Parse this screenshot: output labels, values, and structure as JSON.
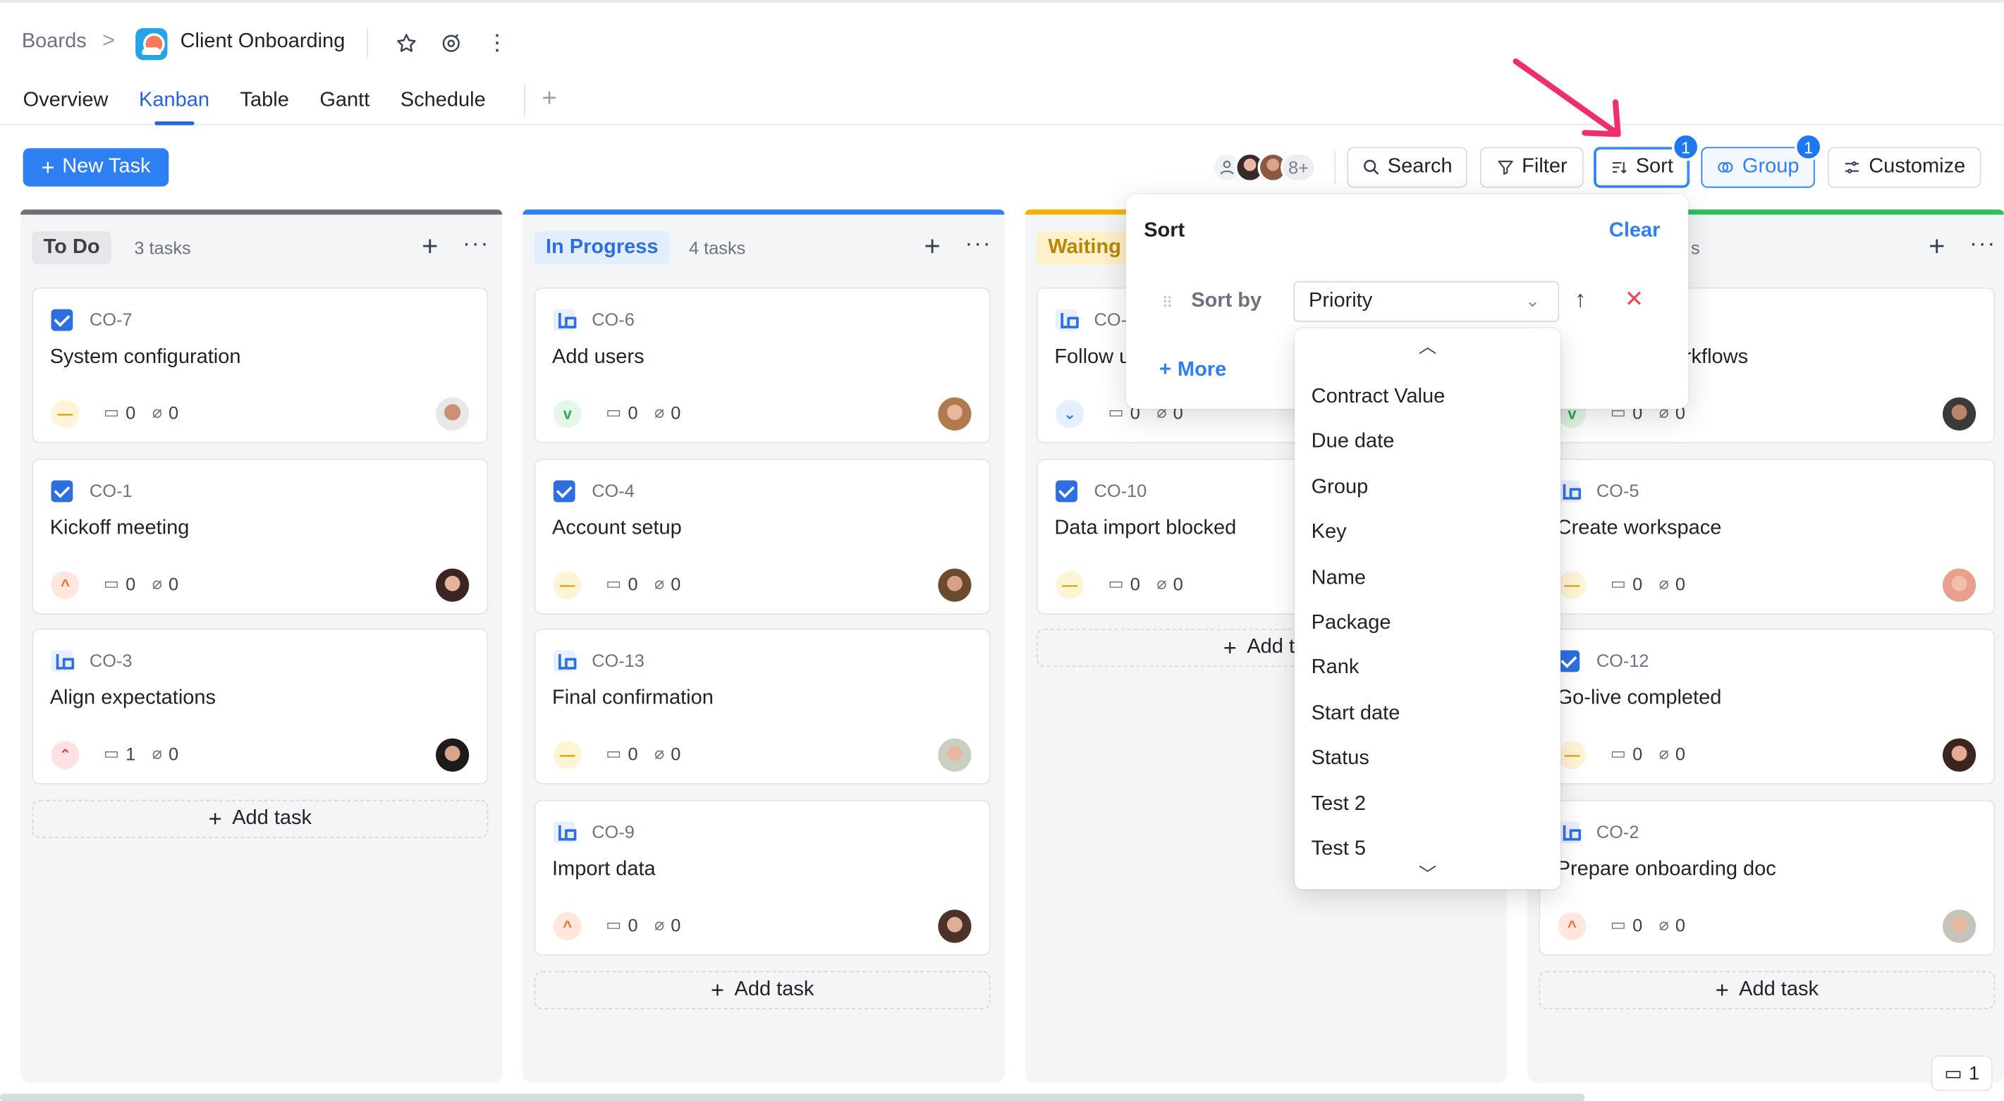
{
  "breadcrumb": {
    "root": "Boards",
    "separator": ">",
    "board_title": "Client Onboarding"
  },
  "header_icons": {
    "star": "star-icon",
    "watch": "watch-icon",
    "more": "⋮"
  },
  "tabs": [
    {
      "label": "Overview",
      "active": false
    },
    {
      "label": "Kanban",
      "active": true
    },
    {
      "label": "Table",
      "active": false
    },
    {
      "label": "Gantt",
      "active": false
    },
    {
      "label": "Schedule",
      "active": false
    }
  ],
  "tab_add": "+",
  "toolbar": {
    "new_task": "New Task",
    "members_more": "8+",
    "search": "Search",
    "filter": "Filter",
    "sort": "Sort",
    "sort_badge": "1",
    "group": "Group",
    "group_badge": "1",
    "customize": "Customize"
  },
  "colors": {
    "accent": "#2d7ff2",
    "todo": "#6b6f76",
    "in_progress": "#2d7ff2",
    "waiting": "#f2b400",
    "done": "#2fbf5b",
    "remove": "#e84a56"
  },
  "columns": [
    {
      "title": "To Do",
      "count": "3 tasks",
      "cards": [
        {
          "type": "check",
          "key": "CO-7",
          "title": "System configuration",
          "priority": "med",
          "priority_glyph": "—",
          "comments": "0",
          "attachments": "0"
        },
        {
          "type": "check",
          "key": "CO-1",
          "title": "Kickoff meeting",
          "priority": "high",
          "priority_glyph": "^",
          "comments": "0",
          "attachments": "0"
        },
        {
          "type": "sub",
          "key": "CO-3",
          "title": "Align expectations",
          "priority": "urgent",
          "priority_glyph": "⌃",
          "comments": "1",
          "attachments": "0"
        }
      ],
      "add_task": "Add task"
    },
    {
      "title": "In Progress",
      "count": "4 tasks",
      "cards": [
        {
          "type": "sub",
          "key": "CO-6",
          "title": "Add users",
          "priority": "low",
          "priority_glyph": "v",
          "comments": "0",
          "attachments": "0"
        },
        {
          "type": "check",
          "key": "CO-4",
          "title": "Account setup",
          "priority": "med",
          "priority_glyph": "—",
          "comments": "0",
          "attachments": "0"
        },
        {
          "type": "sub",
          "key": "CO-13",
          "title": "Final confirmation",
          "priority": "med",
          "priority_glyph": "—",
          "comments": "0",
          "attachments": "0"
        },
        {
          "type": "sub",
          "key": "CO-9",
          "title": "Import data",
          "priority": "high",
          "priority_glyph": "^",
          "comments": "0",
          "attachments": "0"
        }
      ],
      "add_task": "Add task"
    },
    {
      "title": "Waiting",
      "count": "",
      "cards": [
        {
          "type": "sub",
          "key": "CO-",
          "title": "Follow u",
          "priority": "lowest",
          "priority_glyph": "⌄",
          "comments": "0",
          "attachments": "0"
        },
        {
          "type": "check",
          "key": "CO-10",
          "title": "Data import blocked",
          "priority": "med",
          "priority_glyph": "—",
          "comments": "0",
          "attachments": "0"
        }
      ],
      "add_task": "Add ta"
    },
    {
      "title": "s",
      "count": "",
      "cards": [
        {
          "type": "none",
          "key": "",
          "title": "rkflows",
          "priority": "low",
          "priority_glyph": "v",
          "comments": "0",
          "attachments": "0"
        },
        {
          "type": "sub",
          "key": "CO-5",
          "title": "Create workspace",
          "priority": "med",
          "priority_glyph": "—",
          "comments": "0",
          "attachments": "0"
        },
        {
          "type": "check",
          "key": "CO-12",
          "title": "Go-live completed",
          "priority": "med",
          "priority_glyph": "—",
          "comments": "0",
          "attachments": "0"
        },
        {
          "type": "sub",
          "key": "CO-2",
          "title": "Prepare onboarding doc",
          "priority": "high",
          "priority_glyph": "^",
          "comments": "0",
          "attachments": "0"
        }
      ],
      "add_task": "Add task"
    }
  ],
  "sort_popover": {
    "title": "Sort",
    "clear": "Clear",
    "sort_by_label": "Sort by",
    "selected": "Priority",
    "more": "More",
    "options": [
      "Contract Value",
      "Due date",
      "Group",
      "Key",
      "Name",
      "Package",
      "Rank",
      "Start date",
      "Status",
      "Test 2",
      "Test 5"
    ]
  },
  "footer": {
    "count": "1"
  }
}
